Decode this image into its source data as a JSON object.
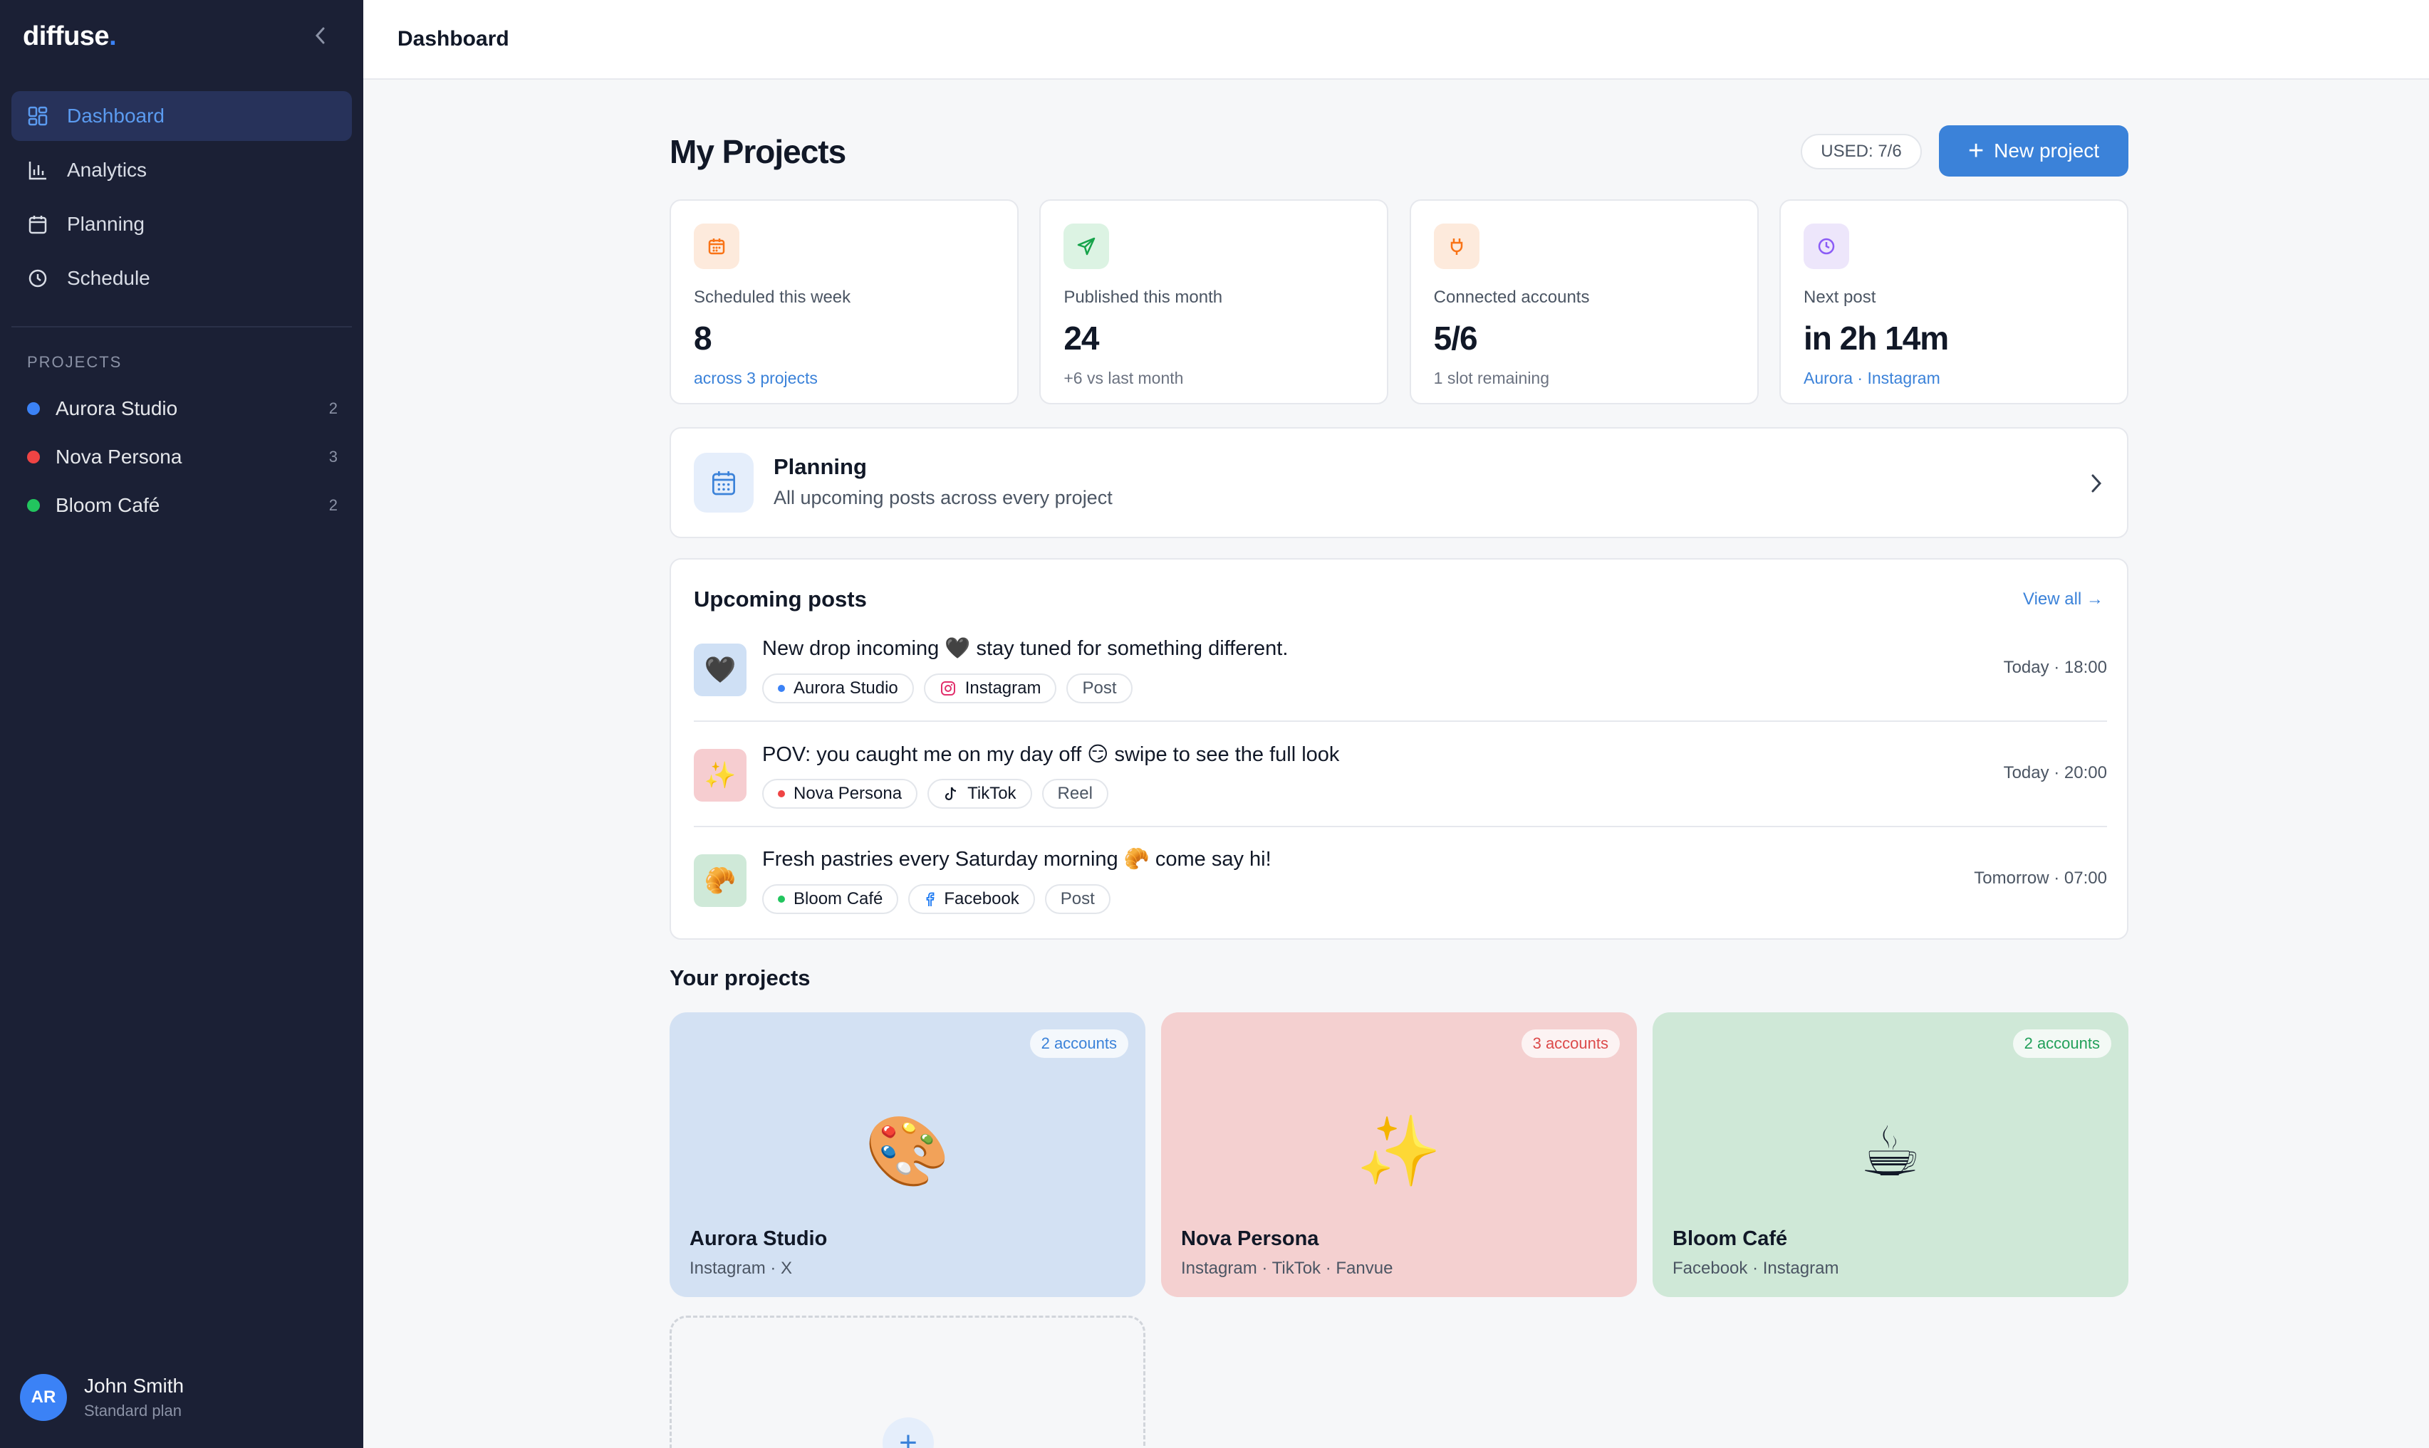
{
  "sidebar": {
    "brand": "diffuse",
    "brand_dot": ".",
    "nav": [
      {
        "label": "Dashboard",
        "icon": "dashboard-grid-icon",
        "active": true
      },
      {
        "label": "Analytics",
        "icon": "bar-chart-icon",
        "active": false
      },
      {
        "label": "Planning",
        "icon": "calendar-icon",
        "active": false
      },
      {
        "label": "Schedule",
        "icon": "clock-icon",
        "active": false
      }
    ],
    "projects_heading": "PROJECTS",
    "projects": [
      {
        "name": "Aurora Studio",
        "count": "2",
        "color": "#3b82f6"
      },
      {
        "name": "Nova Persona",
        "count": "3",
        "color": "#ef4444"
      },
      {
        "name": "Bloom Café",
        "count": "2",
        "color": "#22c55e"
      }
    ],
    "user": {
      "initials": "AR",
      "name": "John Smith",
      "plan": "Standard plan"
    }
  },
  "topbar": {
    "title": "Dashboard"
  },
  "main": {
    "title": "My Projects",
    "used_badge": "USED: 7/6",
    "new_project_label": "New project",
    "stats": [
      {
        "label": "Scheduled this week",
        "value": "8",
        "sub": "across 3 projects",
        "icon": "calendar-icon",
        "accent": "#f97316"
      },
      {
        "label": "Published this month",
        "value": "24",
        "sub": "+6 vs last month",
        "icon": "send-icon",
        "accent": "#16a34a"
      },
      {
        "label": "Connected accounts",
        "value": "5/6",
        "sub": "1 slot remaining",
        "icon": "plug-icon",
        "accent": "#f97316"
      },
      {
        "label": "Next post",
        "value": "in 2h 14m",
        "sub": "Aurora · Instagram",
        "icon": "clock-icon",
        "accent": "#8b5cf6"
      }
    ],
    "planning": {
      "title": "Planning",
      "subtitle": "All upcoming posts across every project"
    },
    "upcoming": {
      "title": "Upcoming posts",
      "view_all": "View all →",
      "posts": [
        {
          "text": "New drop incoming 🖤 stay tuned for something different.",
          "emoji": "🖤",
          "project": "Aurora Studio",
          "project_color": "#3b82f6",
          "platform": "Instagram",
          "platform_icon": "instagram-icon",
          "type": "Post",
          "time": "Today · 18:00",
          "thumb_bg": "#cfe0f5"
        },
        {
          "text": "POV: you caught me on my day off 😏 swipe to see the full look",
          "emoji": "✨",
          "project": "Nova Persona",
          "project_color": "#ef4444",
          "platform": "TikTok",
          "platform_icon": "tiktok-icon",
          "type": "Reel",
          "time": "Today · 20:00",
          "thumb_bg": "#f6cdd0"
        },
        {
          "text": "Fresh pastries every Saturday morning 🥐 come say hi!",
          "emoji": "🥐",
          "project": "Bloom Café",
          "project_color": "#22c55e",
          "platform": "Facebook",
          "platform_icon": "facebook-icon",
          "type": "Post",
          "time": "Tomorrow · 07:00",
          "thumb_bg": "#cfe9d8"
        }
      ]
    },
    "your_projects": {
      "title": "Your projects",
      "cards": [
        {
          "name": "Aurora Studio",
          "platforms": "Instagram · X",
          "accounts": "2 accounts",
          "emoji": "🎨",
          "bg": "#d3e1f3",
          "accent": "#3b82d9"
        },
        {
          "name": "Nova Persona",
          "platforms": "Instagram · TikTok · Fanvue",
          "accounts": "3 accounts",
          "emoji": "✨",
          "bg": "#f4d0d0",
          "accent": "#dc4a4a"
        },
        {
          "name": "Bloom Café",
          "platforms": "Facebook · Instagram",
          "accounts": "2 accounts",
          "emoji": "☕",
          "bg": "#cfe8d7",
          "accent": "#22a05a"
        }
      ],
      "add_label": "+"
    }
  }
}
